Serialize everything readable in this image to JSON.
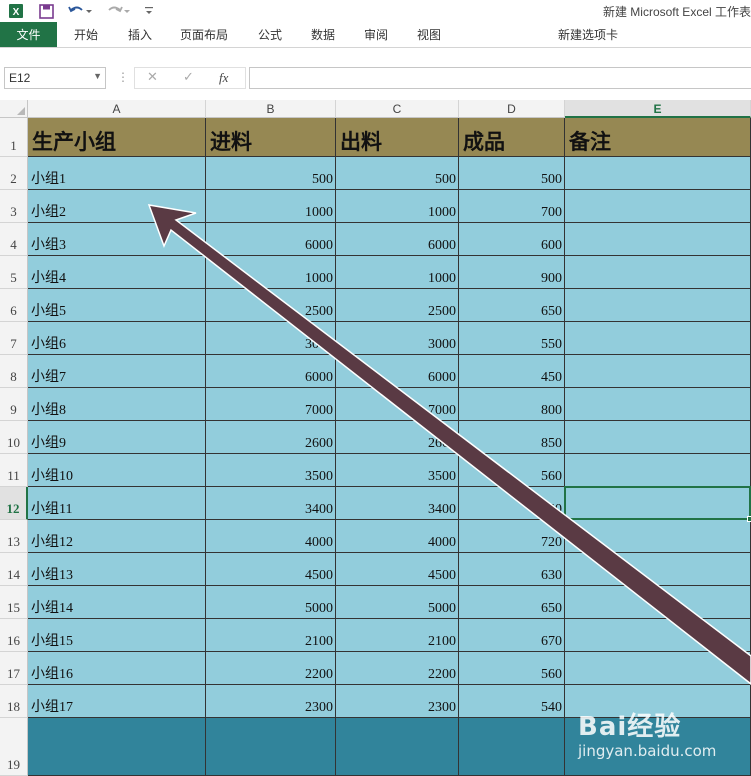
{
  "titlebar": {
    "title": "新建 Microsoft Excel 工作表",
    "icons": [
      "excel-logo-icon",
      "save-icon",
      "undo-icon",
      "redo-icon",
      "customize-icon"
    ]
  },
  "ribbon": {
    "file_tab": "文件",
    "tabs": [
      "开始",
      "插入",
      "页面布局",
      "公式",
      "数据",
      "审阅",
      "视图"
    ],
    "extra_tab": "新建选项卡"
  },
  "formula_bar": {
    "name_box": "E12",
    "fx_label": "fx",
    "formula": ""
  },
  "grid": {
    "columns": [
      "A",
      "B",
      "C",
      "D",
      "E"
    ],
    "selected_column": "E",
    "selected_row": "12",
    "rows": [
      "1",
      "2",
      "3",
      "4",
      "5",
      "6",
      "7",
      "8",
      "9",
      "10",
      "11",
      "12",
      "13",
      "14",
      "15",
      "16",
      "17",
      "18",
      "19"
    ],
    "headers": [
      "生产小组",
      "进料",
      "出料",
      "成品",
      "备注"
    ],
    "data": [
      [
        "小组1",
        "500",
        "500",
        "500",
        ""
      ],
      [
        "小组2",
        "1000",
        "1000",
        "700",
        ""
      ],
      [
        "小组3",
        "6000",
        "6000",
        "600",
        ""
      ],
      [
        "小组4",
        "1000",
        "1000",
        "900",
        ""
      ],
      [
        "小组5",
        "2500",
        "2500",
        "650",
        ""
      ],
      [
        "小组6",
        "3000",
        "3000",
        "550",
        ""
      ],
      [
        "小组7",
        "6000",
        "6000",
        "450",
        ""
      ],
      [
        "小组8",
        "7000",
        "7000",
        "800",
        ""
      ],
      [
        "小组9",
        "2600",
        "2600",
        "850",
        ""
      ],
      [
        "小组10",
        "3500",
        "3500",
        "560",
        ""
      ],
      [
        "小组11",
        "3400",
        "3400",
        "540",
        ""
      ],
      [
        "小组12",
        "4000",
        "4000",
        "720",
        ""
      ],
      [
        "小组13",
        "4500",
        "4500",
        "630",
        ""
      ],
      [
        "小组14",
        "5000",
        "5000",
        "650",
        ""
      ],
      [
        "小组15",
        "2100",
        "2100",
        "670",
        ""
      ],
      [
        "小组16",
        "2200",
        "2200",
        "560",
        ""
      ],
      [
        "小组17",
        "2300",
        "2300",
        "540",
        ""
      ]
    ]
  },
  "colors": {
    "header_fill": "#968853",
    "body_fill": "#92cddc",
    "footer_fill": "#31849b",
    "accent": "#217346",
    "arrow": "#5a3a44"
  },
  "watermark": {
    "brand": "Bai经验",
    "url": "jingyan.baidu.com"
  }
}
